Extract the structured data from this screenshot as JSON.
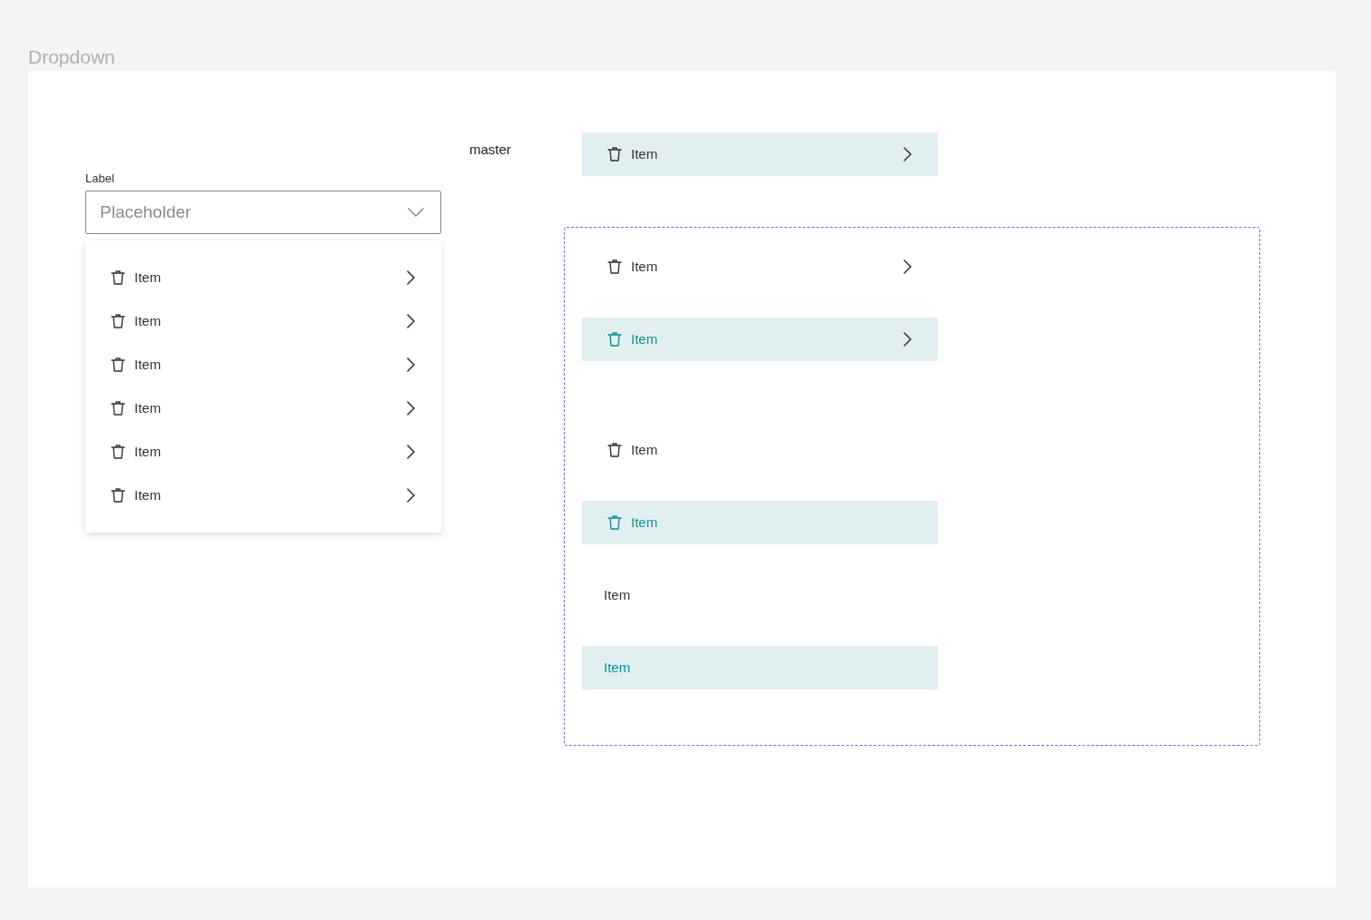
{
  "page_title": "Dropdown",
  "dropdown": {
    "label": "Label",
    "placeholder": "Placeholder",
    "expanded": true,
    "menu_items": [
      {
        "label": "Item",
        "icon": true,
        "chevron": true
      },
      {
        "label": "Item",
        "icon": true,
        "chevron": true
      },
      {
        "label": "Item",
        "icon": true,
        "chevron": true
      },
      {
        "label": "Item",
        "icon": true,
        "chevron": true
      },
      {
        "label": "Item",
        "icon": true,
        "chevron": true
      },
      {
        "label": "Item",
        "icon": true,
        "chevron": true
      }
    ]
  },
  "master": {
    "caption": "master",
    "item": {
      "label": "Item",
      "icon": true,
      "chevron": true,
      "highlighted": true,
      "selected": false
    }
  },
  "variants": [
    {
      "label": "Item",
      "icon": true,
      "chevron": true,
      "highlighted": false,
      "selected": false
    },
    {
      "label": "Item",
      "icon": true,
      "chevron": true,
      "highlighted": true,
      "selected": true
    },
    {
      "label": "Item",
      "icon": true,
      "chevron": false,
      "highlighted": false,
      "selected": false
    },
    {
      "label": "Item",
      "icon": true,
      "chevron": false,
      "highlighted": true,
      "selected": true
    },
    {
      "label": "Item",
      "icon": false,
      "chevron": false,
      "highlighted": false,
      "selected": false
    },
    {
      "label": "Item",
      "icon": false,
      "chevron": false,
      "highlighted": true,
      "selected": true
    }
  ]
}
